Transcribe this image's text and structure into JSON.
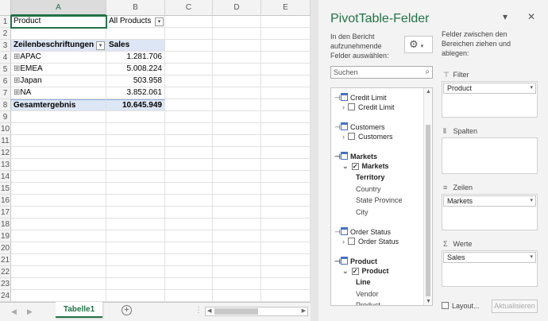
{
  "grid": {
    "columns": [
      "A",
      "B",
      "C",
      "D",
      "E"
    ],
    "rows": [
      "1",
      "2",
      "3",
      "4",
      "5",
      "6",
      "7",
      "8",
      "9",
      "10",
      "11",
      "12",
      "13",
      "14",
      "15",
      "16",
      "17",
      "18",
      "19",
      "20",
      "21",
      "22",
      "23",
      "24"
    ],
    "cells": {
      "a1": "Product",
      "b1": "All Products",
      "a3": "Zeilenbeschriftungen",
      "b3": "Sales",
      "a4": "APAC",
      "b4": "1.281.706",
      "a5": "EMEA",
      "b5": "5.008.224",
      "a6": "Japan",
      "b6": "503.958",
      "a7": "NA",
      "b7": "3.852.061",
      "a8": "Gesamtergebnis",
      "b8": "10.645.949"
    },
    "expand_glyph": "⊞",
    "dropdown_glyph": "▾"
  },
  "sheet_tabs": {
    "active": "Tabelle1",
    "add_glyph": "+",
    "nav_left": "◀",
    "nav_right": "▶"
  },
  "pane": {
    "title": "PivotTable-Felder",
    "dropdown_icon": "▾",
    "close_icon": "✕",
    "instructions_left": "In den Bericht aufzunehmende Felder auswählen:",
    "instructions_right": "Felder zwischen den Bereichen ziehen und ablegen:",
    "gear_icon": "⚙",
    "search_placeholder": "Suchen",
    "search_icon": "⌕",
    "tables": [
      {
        "name": "Credit Limit",
        "field": "Credit Limit",
        "checked": false,
        "subs": []
      },
      {
        "name": "Customers",
        "field": "Customers",
        "checked": false,
        "subs": []
      },
      {
        "name": "Markets",
        "field": "Markets",
        "checked": true,
        "subs": [
          "Territory",
          "Country",
          "State Province",
          "City"
        ]
      },
      {
        "name": "Order Status",
        "field": "Order Status",
        "checked": false,
        "subs": []
      },
      {
        "name": "Product",
        "field": "Product",
        "checked": true,
        "subs": [
          "Line",
          "Vendor",
          "Product"
        ]
      }
    ],
    "areas": {
      "filter_label": "Filter",
      "filter_icon": "⊤",
      "filter_item": "Product",
      "columns_label": "Spalten",
      "columns_icon": "⦀",
      "rows_label": "Zeilen",
      "rows_icon": "≡",
      "rows_item": "Markets",
      "values_label": "Werte",
      "values_icon": "Σ",
      "values_item": "Sales"
    },
    "defer_label": "Layout...",
    "update_button": "Aktualisieren"
  }
}
